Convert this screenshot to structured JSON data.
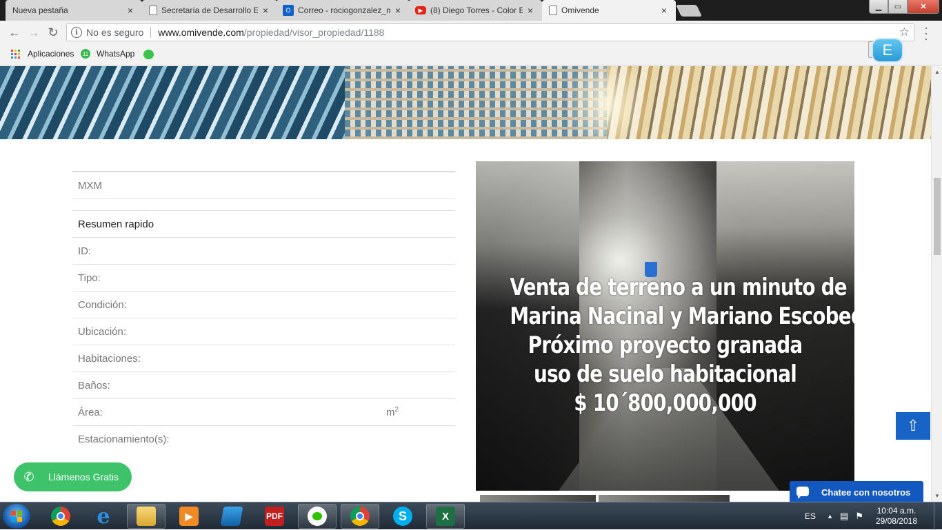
{
  "browser": {
    "tabs": [
      {
        "title": "Nueva pestaña",
        "favicon": "blank-page-icon",
        "active": false
      },
      {
        "title": "Secretaría de Desarrollo E",
        "favicon": "page-icon",
        "active": false
      },
      {
        "title": "Correo - rociogonzalez_m",
        "favicon": "outlook-icon",
        "active": false
      },
      {
        "title": "(8) Diego Torres - Color E",
        "favicon": "youtube-icon",
        "active": false
      },
      {
        "title": "Omivende",
        "favicon": "page-icon",
        "active": true
      }
    ],
    "tab_close_glyph": "×",
    "window_buttons": {
      "minimize": "▁",
      "maximize": "▭",
      "close": "✕"
    },
    "security_label": "No es seguro",
    "url_host": "www.omivende.com",
    "url_path": "/propiedad/visor_propiedad/1188",
    "bookmarks": [
      {
        "label": "Aplicaciones"
      },
      {
        "label": "WhatsApp"
      }
    ],
    "extension_label": "E"
  },
  "page": {
    "currency": "MXM",
    "summary_title": "Resumen rapido",
    "fields": [
      {
        "label": "ID:"
      },
      {
        "label": "Tipo:"
      },
      {
        "label": "Condición:"
      },
      {
        "label": "Ubicación:"
      },
      {
        "label": "Habitaciones:"
      },
      {
        "label": "Baños:"
      },
      {
        "label": "Área:",
        "unit": "m",
        "unit_sup": "2"
      },
      {
        "label": "Estacionamiento(s):"
      }
    ],
    "image_overlay_lines": [
      "Venta de terreno  a un minuto de",
      "Marina Nacinal y Mariano Escobedo",
      "Próximo proyecto granada",
      "uso de suelo habitacional",
      "$ 10´800,000,000"
    ],
    "call_button": "Llámenos Gratis",
    "chat_button": "Chatee con nosotros",
    "scroll_top_glyph": "🡡"
  },
  "taskbar": {
    "language": "ES",
    "time": "10:04 a.m.",
    "date": "29/08/2018",
    "apps": [
      "chrome-icon",
      "internet-explorer-icon",
      "file-explorer-icon",
      "media-player-icon",
      "spreadsheet-app-icon",
      "pdf-reader-icon",
      "wechat-icon",
      "chrome-icon",
      "skype-icon",
      "excel-icon"
    ]
  },
  "colors": {
    "call_green": "#3ec36b",
    "chat_blue": "#1258be",
    "scroll_top_blue": "#1763c6"
  }
}
